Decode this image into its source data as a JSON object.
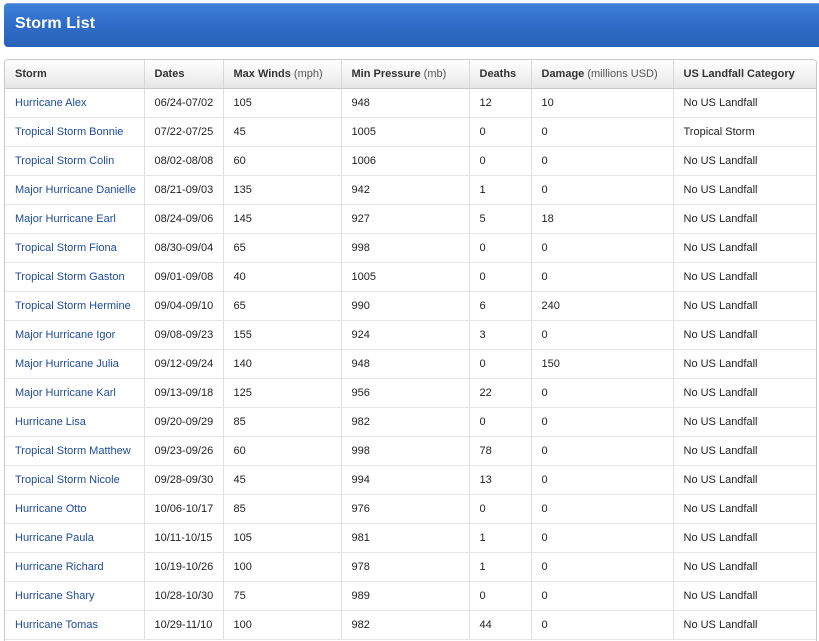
{
  "header": {
    "title": "Storm List"
  },
  "table": {
    "columns": [
      {
        "label": "Storm",
        "unit": ""
      },
      {
        "label": "Dates",
        "unit": ""
      },
      {
        "label": "Max Winds",
        "unit": "(mph)"
      },
      {
        "label": "Min Pressure",
        "unit": "(mb)"
      },
      {
        "label": "Deaths",
        "unit": ""
      },
      {
        "label": "Damage",
        "unit": "(millions USD)"
      },
      {
        "label": "US Landfall Category",
        "unit": ""
      }
    ],
    "rows": [
      {
        "storm": "Hurricane Alex",
        "dates": "06/24-07/02",
        "winds": "105",
        "pressure": "948",
        "deaths": "12",
        "damage": "10",
        "landfall": "No US Landfall"
      },
      {
        "storm": "Tropical Storm Bonnie",
        "dates": "07/22-07/25",
        "winds": "45",
        "pressure": "1005",
        "deaths": "0",
        "damage": "0",
        "landfall": "Tropical Storm"
      },
      {
        "storm": "Tropical Storm Colin",
        "dates": "08/02-08/08",
        "winds": "60",
        "pressure": "1006",
        "deaths": "0",
        "damage": "0",
        "landfall": "No US Landfall"
      },
      {
        "storm": "Major Hurricane Danielle",
        "dates": "08/21-09/03",
        "winds": "135",
        "pressure": "942",
        "deaths": "1",
        "damage": "0",
        "landfall": "No US Landfall"
      },
      {
        "storm": "Major Hurricane Earl",
        "dates": "08/24-09/06",
        "winds": "145",
        "pressure": "927",
        "deaths": "5",
        "damage": "18",
        "landfall": "No US Landfall"
      },
      {
        "storm": "Tropical Storm Fiona",
        "dates": "08/30-09/04",
        "winds": "65",
        "pressure": "998",
        "deaths": "0",
        "damage": "0",
        "landfall": "No US Landfall"
      },
      {
        "storm": "Tropical Storm Gaston",
        "dates": "09/01-09/08",
        "winds": "40",
        "pressure": "1005",
        "deaths": "0",
        "damage": "0",
        "landfall": "No US Landfall"
      },
      {
        "storm": "Tropical Storm Hermine",
        "dates": "09/04-09/10",
        "winds": "65",
        "pressure": "990",
        "deaths": "6",
        "damage": "240",
        "landfall": "No US Landfall"
      },
      {
        "storm": "Major Hurricane Igor",
        "dates": "09/08-09/23",
        "winds": "155",
        "pressure": "924",
        "deaths": "3",
        "damage": "0",
        "landfall": "No US Landfall"
      },
      {
        "storm": "Major Hurricane Julia",
        "dates": "09/12-09/24",
        "winds": "140",
        "pressure": "948",
        "deaths": "0",
        "damage": "150",
        "landfall": "No US Landfall"
      },
      {
        "storm": "Major Hurricane Karl",
        "dates": "09/13-09/18",
        "winds": "125",
        "pressure": "956",
        "deaths": "22",
        "damage": "0",
        "landfall": "No US Landfall"
      },
      {
        "storm": "Hurricane Lisa",
        "dates": "09/20-09/29",
        "winds": "85",
        "pressure": "982",
        "deaths": "0",
        "damage": "0",
        "landfall": "No US Landfall"
      },
      {
        "storm": "Tropical Storm Matthew",
        "dates": "09/23-09/26",
        "winds": "60",
        "pressure": "998",
        "deaths": "78",
        "damage": "0",
        "landfall": "No US Landfall"
      },
      {
        "storm": "Tropical Storm Nicole",
        "dates": "09/28-09/30",
        "winds": "45",
        "pressure": "994",
        "deaths": "13",
        "damage": "0",
        "landfall": "No US Landfall"
      },
      {
        "storm": "Hurricane Otto",
        "dates": "10/06-10/17",
        "winds": "85",
        "pressure": "976",
        "deaths": "0",
        "damage": "0",
        "landfall": "No US Landfall"
      },
      {
        "storm": "Hurricane Paula",
        "dates": "10/11-10/15",
        "winds": "105",
        "pressure": "981",
        "deaths": "1",
        "damage": "0",
        "landfall": "No US Landfall"
      },
      {
        "storm": "Hurricane Richard",
        "dates": "10/19-10/26",
        "winds": "100",
        "pressure": "978",
        "deaths": "1",
        "damage": "0",
        "landfall": "No US Landfall"
      },
      {
        "storm": "Hurricane Shary",
        "dates": "10/28-10/30",
        "winds": "75",
        "pressure": "989",
        "deaths": "0",
        "damage": "0",
        "landfall": "No US Landfall"
      },
      {
        "storm": "Hurricane Tomas",
        "dates": "10/29-11/10",
        "winds": "100",
        "pressure": "982",
        "deaths": "44",
        "damage": "0",
        "landfall": "No US Landfall"
      }
    ]
  },
  "colors": {
    "header_bar": "#2f6cc7",
    "link": "#1f4a9a",
    "text": "#222222"
  }
}
